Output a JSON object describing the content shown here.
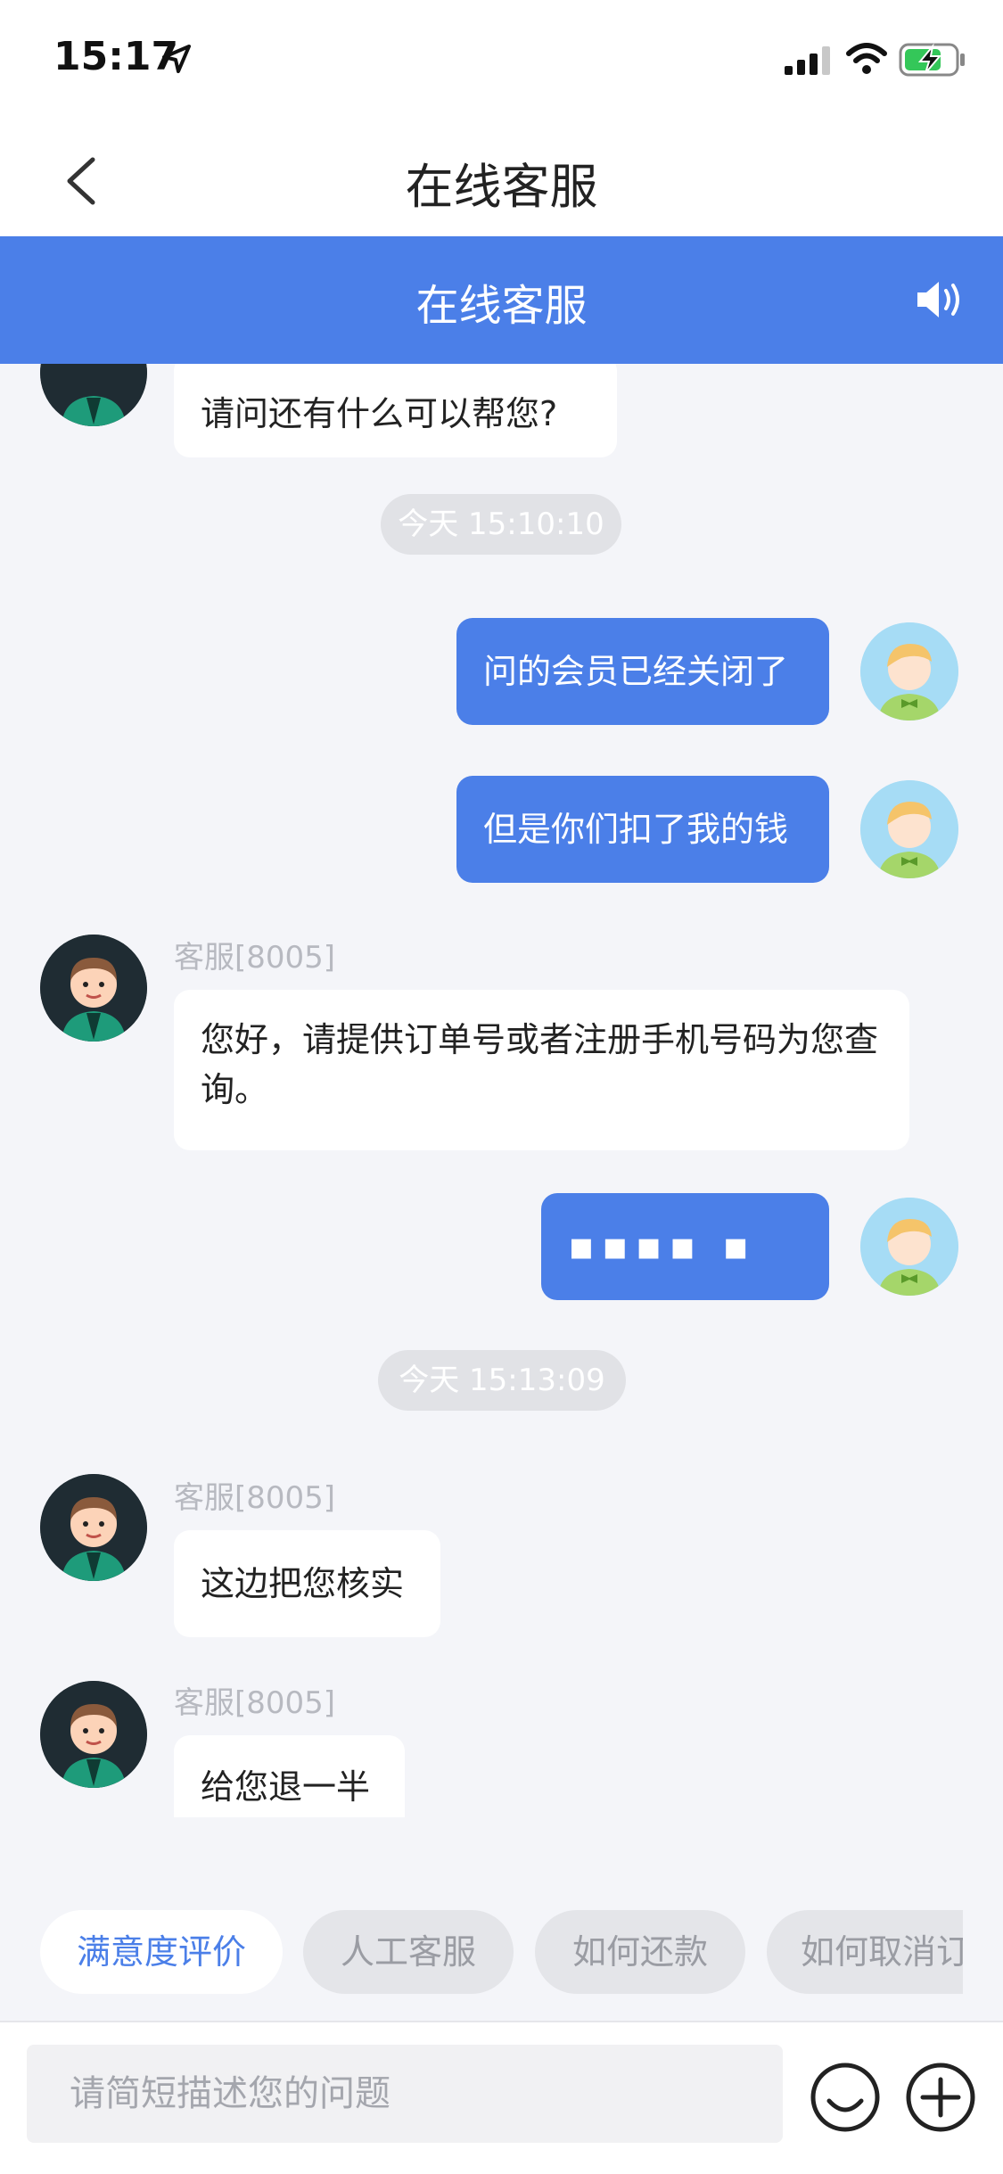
{
  "status_bar": {
    "time": "15:17"
  },
  "nav": {
    "title": "在线客服"
  },
  "banner": {
    "title": "在线客服"
  },
  "messages": [
    {
      "text": "请问还有什么可以帮您?"
    },
    {
      "timestamp": "今天 15:10:10"
    },
    {
      "text": "问的会员已经关闭了"
    },
    {
      "text": "但是你们扣了我的钱"
    },
    {
      "sender": "客服[8005]",
      "text": "您好，请提供订单号或者注册手机号码为您查询。"
    },
    {
      "text": "▪▪▪▪ ▪"
    },
    {
      "timestamp": "今天 15:13:09"
    },
    {
      "sender": "客服[8005]",
      "text": "这边把您核实"
    },
    {
      "sender": "客服[8005]",
      "text": "给您退一半"
    }
  ],
  "quick_replies": [
    "满意度评价",
    "人工客服",
    "如何还款",
    "如何取消订"
  ],
  "input": {
    "placeholder": "请简短描述您的问题",
    "value": ""
  },
  "colors": {
    "accent": "#4b7fe8",
    "background": "#f4f5f9"
  }
}
